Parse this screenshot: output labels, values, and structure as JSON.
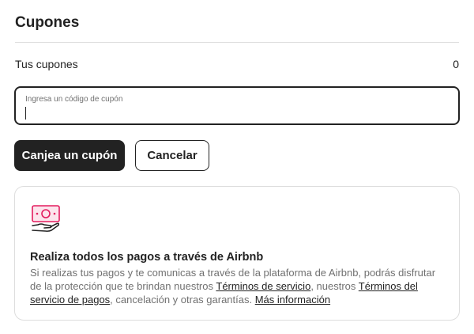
{
  "page": {
    "title": "Cupones"
  },
  "coupons": {
    "label": "Tus cupones",
    "count": "0"
  },
  "code_input": {
    "label": "Ingresa un código de cupón",
    "value": ""
  },
  "buttons": {
    "redeem": "Canjea un cupón",
    "cancel": "Cancelar"
  },
  "info_card": {
    "icon": "hand-holding-banknote-icon",
    "heading": "Realiza todos los pagos a través de Airbnb",
    "text_1": "Si realizas tus pagos y te comunicas a través de la plataforma de Airbnb, podrás disfrutar de la protección que te brindan nuestros ",
    "link_terms": "Términos de servicio",
    "text_2": ", nuestros ",
    "link_payment_terms": "Términos del servicio de pagos",
    "text_3": ", cancelación y otras garantías. ",
    "link_more": "Más información"
  },
  "colors": {
    "primary_button": "#222222",
    "accent_icon": "#E31C5F",
    "muted_text": "#717171",
    "border": "#DDDDDD"
  }
}
